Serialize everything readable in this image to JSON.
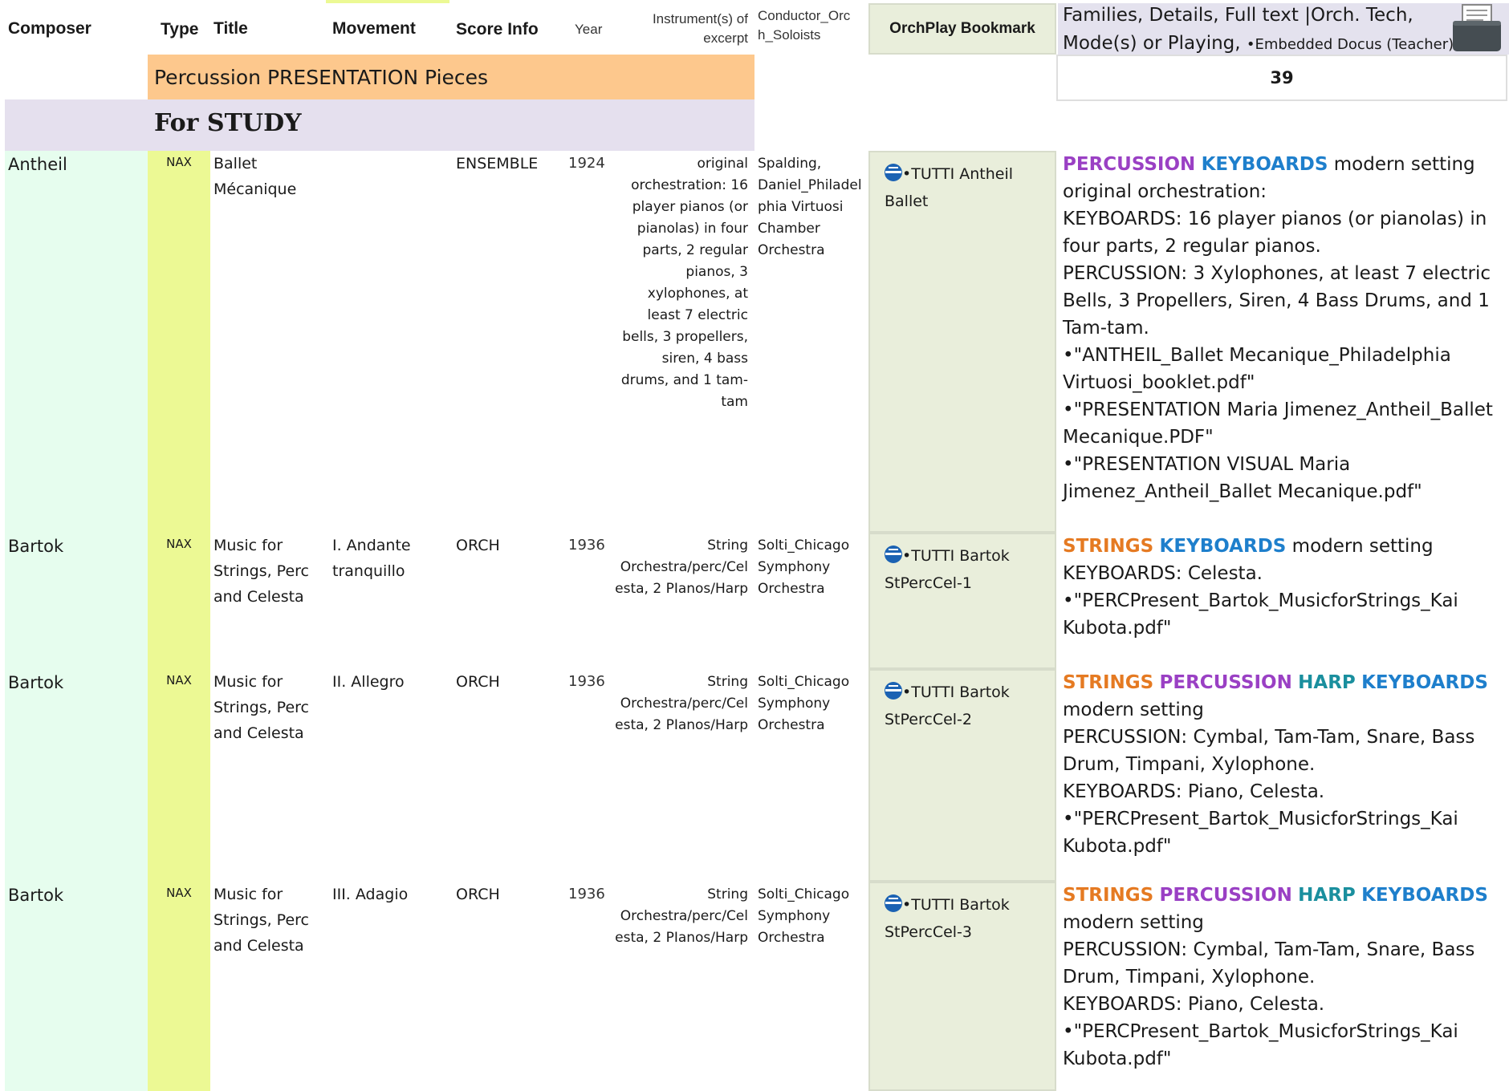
{
  "header": {
    "composer": "Composer",
    "type": "Type",
    "title": "Title",
    "movement": "Movement",
    "score_info": "Score Info",
    "year": "Year",
    "instruments": [
      "Instrument(s) of",
      "excerpt"
    ],
    "conductor": [
      "Conductor_Orc",
      "h_Soloists"
    ],
    "bookmark": "OrchPlay Bookmark",
    "families_line1": "Families, Details, Full text |Orch. Tech,",
    "families_line2": "Mode(s) or Playing, ",
    "families_embedded": "•Embedded Docus (Teacher)"
  },
  "section_title": "Percussion PRESENTATION Pieces",
  "section_count": "39",
  "study_label": "For STUDY",
  "rows": [
    {
      "composer": "Antheil",
      "type": "NAX",
      "title": [
        "Ballet",
        "Mécanique"
      ],
      "movement": [],
      "score_info": "ENSEMBLE",
      "year": "1924",
      "instruments": [
        "original",
        "orchestration: 16",
        "player pianos (or",
        "pianolas) in four",
        "parts, 2 regular",
        "pianos, 3",
        "xylophones, at",
        "least 7 electric",
        "bells, 3 propellers,",
        "siren, 4 bass",
        "drums, and 1 tam-",
        "tam"
      ],
      "conductor": [
        "Spalding,",
        "Daniel_Philadel",
        "phia Virtuosi",
        "Chamber",
        "Orchestra"
      ],
      "bookmark": [
        "•TUTTI Antheil",
        "Ballet"
      ],
      "families": [
        {
          "parts": [
            {
              "t": "PERCUSSION",
              "c": "perc"
            },
            {
              "t": " "
            },
            {
              "t": "KEYBOARDS",
              "c": "keys"
            },
            {
              "t": " modern setting"
            }
          ]
        },
        {
          "parts": [
            {
              "t": "original orchestration:"
            }
          ]
        },
        {
          "parts": [
            {
              "t": "KEYBOARDS: 16 player pianos (or pianolas) in"
            }
          ]
        },
        {
          "parts": [
            {
              "t": "four parts, 2 regular pianos."
            }
          ]
        },
        {
          "parts": [
            {
              "t": "PERCUSSION: 3 Xylophones, at least 7 electric"
            }
          ]
        },
        {
          "parts": [
            {
              "t": "Bells, 3 Propellers, Siren, 4 Bass Drums, and 1"
            }
          ]
        },
        {
          "parts": [
            {
              "t": "Tam-tam."
            }
          ]
        },
        {
          "parts": [
            {
              "t": "•\"ANTHEIL_Ballet Mecanique_Philadelphia"
            }
          ]
        },
        {
          "parts": [
            {
              "t": "Virtuosi_booklet.pdf\""
            }
          ]
        },
        {
          "parts": [
            {
              "t": "•\"PRESENTATION Maria Jimenez_Antheil_Ballet"
            }
          ]
        },
        {
          "parts": [
            {
              "t": "Mecanique.PDF\""
            }
          ]
        },
        {
          "parts": [
            {
              "t": "•\"PRESENTATION VISUAL Maria"
            }
          ]
        },
        {
          "parts": [
            {
              "t": "Jimenez_Antheil_Ballet Mecanique.pdf\""
            }
          ]
        }
      ]
    },
    {
      "composer": "Bartok",
      "type": "NAX",
      "title": [
        "Music for",
        "Strings, Perc",
        "and Celesta"
      ],
      "movement": [
        "I. Andante",
        "tranquillo"
      ],
      "score_info": "ORCH",
      "year": "1936",
      "instruments": [
        "String",
        "Orchestra/perc/Cel",
        "esta, 2 PIanos/Harp"
      ],
      "conductor": [
        "Solti_Chicago",
        "Symphony",
        "Orchestra"
      ],
      "bookmark": [
        "•TUTTI Bartok",
        "StPercCel-1"
      ],
      "families": [
        {
          "parts": [
            {
              "t": "STRINGS",
              "c": "str"
            },
            {
              "t": " "
            },
            {
              "t": "KEYBOARDS",
              "c": "keys"
            },
            {
              "t": " modern setting"
            }
          ]
        },
        {
          "parts": [
            {
              "t": "KEYBOARDS: Celesta."
            }
          ]
        },
        {
          "parts": [
            {
              "t": "•\"PERCPresent_Bartok_MusicforStrings_Kai"
            }
          ]
        },
        {
          "parts": [
            {
              "t": "Kubota.pdf\""
            }
          ]
        }
      ]
    },
    {
      "composer": "Bartok",
      "type": "NAX",
      "title": [
        "Music for",
        "Strings, Perc",
        "and Celesta"
      ],
      "movement": [
        "II. Allegro"
      ],
      "score_info": "ORCH",
      "year": "1936",
      "instruments": [
        "String",
        "Orchestra/perc/Cel",
        "esta, 2 PIanos/Harp"
      ],
      "conductor": [
        "Solti_Chicago",
        "Symphony",
        "Orchestra"
      ],
      "bookmark": [
        "•TUTTI Bartok",
        "StPercCel-2"
      ],
      "families": [
        {
          "parts": [
            {
              "t": "STRINGS",
              "c": "str"
            },
            {
              "t": " "
            },
            {
              "t": "PERCUSSION",
              "c": "perc"
            },
            {
              "t": " "
            },
            {
              "t": "HARP",
              "c": "harp"
            },
            {
              "t": " "
            },
            {
              "t": "KEYBOARDS",
              "c": "keys"
            }
          ]
        },
        {
          "parts": [
            {
              "t": "modern setting"
            }
          ]
        },
        {
          "parts": [
            {
              "t": "PERCUSSION: Cymbal, Tam-Tam, Snare, Bass"
            }
          ]
        },
        {
          "parts": [
            {
              "t": "Drum, Timpani, Xylophone."
            }
          ]
        },
        {
          "parts": [
            {
              "t": "KEYBOARDS: Piano, Celesta."
            }
          ]
        },
        {
          "parts": [
            {
              "t": "•\"PERCPresent_Bartok_MusicforStrings_Kai"
            }
          ]
        },
        {
          "parts": [
            {
              "t": "Kubota.pdf\""
            }
          ]
        }
      ]
    },
    {
      "composer": "Bartok",
      "type": "NAX",
      "title": [
        "Music for",
        "Strings, Perc",
        "and Celesta"
      ],
      "movement": [
        "III. Adagio"
      ],
      "score_info": "ORCH",
      "year": "1936",
      "instruments": [
        "String",
        "Orchestra/perc/Cel",
        "esta, 2 PIanos/Harp"
      ],
      "conductor": [
        "Solti_Chicago",
        "Symphony",
        "Orchestra"
      ],
      "bookmark": [
        "•TUTTI Bartok",
        "StPercCel-3"
      ],
      "families": [
        {
          "parts": [
            {
              "t": "STRINGS",
              "c": "str"
            },
            {
              "t": " "
            },
            {
              "t": "PERCUSSION",
              "c": "perc"
            },
            {
              "t": " "
            },
            {
              "t": "HARP",
              "c": "harp"
            },
            {
              "t": " "
            },
            {
              "t": "KEYBOARDS",
              "c": "keys"
            }
          ]
        },
        {
          "parts": [
            {
              "t": "modern setting"
            }
          ]
        },
        {
          "parts": [
            {
              "t": "PERCUSSION: Cymbal, Tam-Tam, Snare, Bass"
            }
          ]
        },
        {
          "parts": [
            {
              "t": "Drum, Timpani, Xylophone."
            }
          ]
        },
        {
          "parts": [
            {
              "t": "KEYBOARDS: Piano, Celesta."
            }
          ]
        },
        {
          "parts": [
            {
              "t": "•\"PERCPresent_Bartok_MusicforStrings_Kai"
            }
          ]
        },
        {
          "parts": [
            {
              "t": "Kubota.pdf\""
            }
          ]
        }
      ]
    }
  ],
  "icons": {
    "bookmark": "globe-icon",
    "printer": "printer-icon"
  },
  "colors": {
    "percussion": "#9a40c4",
    "keyboards": "#1e7fcc",
    "strings": "#e57a22",
    "harp": "#1a8f9e",
    "section": "#fdc88d",
    "study": "#e5e0ee",
    "composer_col": "#e6fdee",
    "type_col": "#ecf994",
    "bookmark": "#e9eedb"
  }
}
